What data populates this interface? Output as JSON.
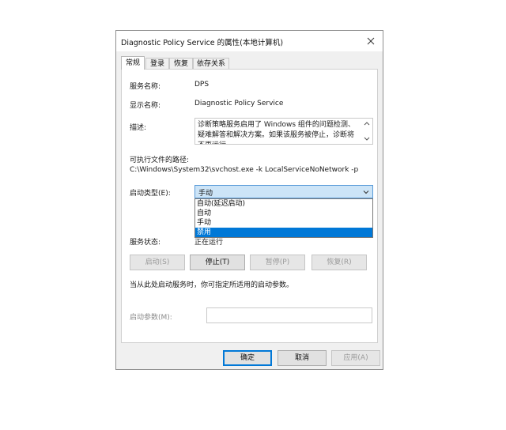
{
  "window": {
    "title": "Diagnostic Policy Service 的属性(本地计算机)"
  },
  "tabs": [
    {
      "label": "常规",
      "active": true
    },
    {
      "label": "登录",
      "active": false
    },
    {
      "label": "恢复",
      "active": false
    },
    {
      "label": "依存关系",
      "active": false
    }
  ],
  "general": {
    "service_name_label": "服务名称:",
    "service_name_value": "DPS",
    "display_name_label": "显示名称:",
    "display_name_value": "Diagnostic Policy Service",
    "description_label": "描述:",
    "description_value": "诊断策略服务启用了 Windows 组件的问题检测、疑难解答和解决方案。如果该服务被停止，诊断将不再运行",
    "exe_path_label": "可执行文件的路径:",
    "exe_path_value": "C:\\Windows\\System32\\svchost.exe -k LocalServiceNoNetwork -p",
    "startup_type_label": "启动类型(E):",
    "startup_type_value": "手动",
    "startup_options": [
      {
        "label": "自动(延迟启动)",
        "selected": false
      },
      {
        "label": "自动",
        "selected": false
      },
      {
        "label": "手动",
        "selected": false
      },
      {
        "label": "禁用",
        "selected": true
      }
    ],
    "service_status_label": "服务状态:",
    "service_status_value": "正在运行",
    "buttons": {
      "start": "启动(S)",
      "stop": "停止(T)",
      "pause": "暂停(P)",
      "resume": "恢复(R)"
    },
    "hint_text": "当从此处启动服务时，你可指定所适用的启动参数。",
    "start_params_label": "启动参数(M):",
    "start_params_value": ""
  },
  "footer": {
    "ok": "确定",
    "cancel": "取消",
    "apply": "应用(A)"
  },
  "colors": {
    "accent": "#0078d7",
    "combo_bg": "#cce4f7"
  }
}
